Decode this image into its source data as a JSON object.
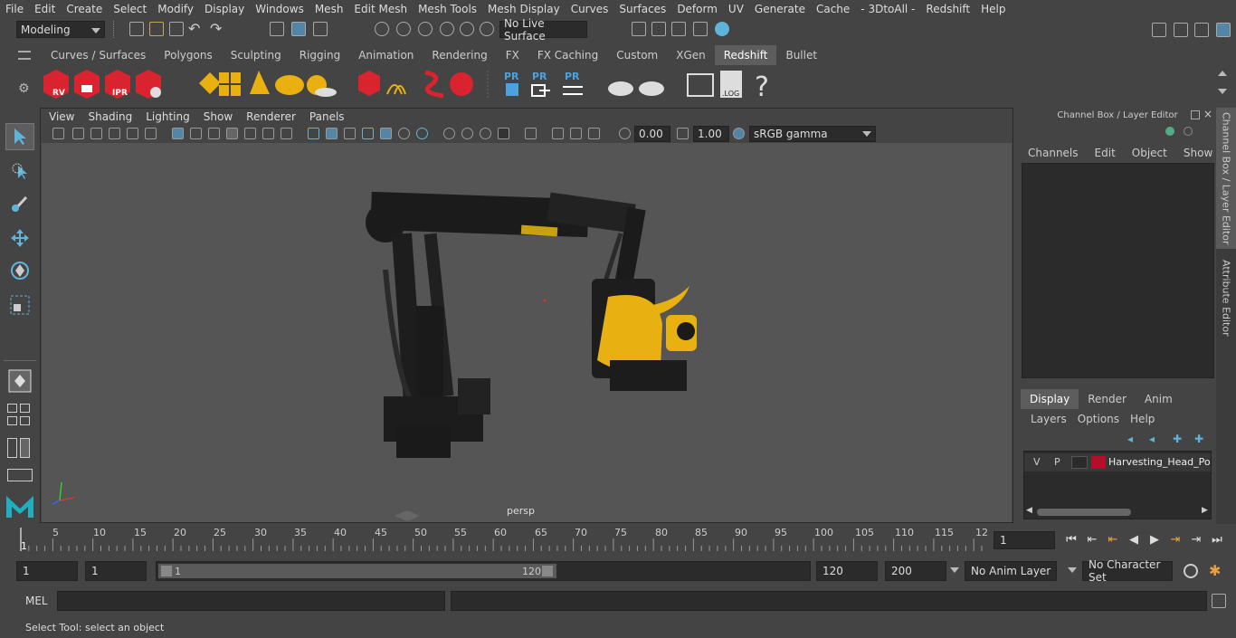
{
  "menubar": {
    "items": [
      "File",
      "Edit",
      "Create",
      "Select",
      "Modify",
      "Display",
      "Windows",
      "Mesh",
      "Edit Mesh",
      "Mesh Tools",
      "Mesh Display",
      "Curves",
      "Surfaces",
      "Deform",
      "UV",
      "Generate",
      "Cache",
      "- 3DtoAll -",
      "Redshift",
      "Help"
    ]
  },
  "status": {
    "workspace": "Modeling",
    "live_surface": "No Live Surface"
  },
  "shelf": {
    "tabs": [
      "Curves / Surfaces",
      "Polygons",
      "Sculpting",
      "Rigging",
      "Animation",
      "Rendering",
      "FX",
      "FX Caching",
      "Custom",
      "XGen",
      "Redshift",
      "Bullet"
    ],
    "active_tab": "Redshift",
    "icon_labels": {
      "rv": "RV",
      "ipr": "IPR",
      "pr": "PR",
      "log": ".LOG",
      "help": "?"
    }
  },
  "panel": {
    "menu": [
      "View",
      "Shading",
      "Lighting",
      "Show",
      "Renderer",
      "Panels"
    ],
    "exposure": "0.00",
    "gamma": "1.00",
    "colorspace": "sRGB gamma",
    "camera_label": "persp"
  },
  "channelbox": {
    "title": "Channel Box / Layer Editor",
    "menu": [
      "Channels",
      "Edit",
      "Object",
      "Show"
    ],
    "layer_tabs": [
      "Display",
      "Render",
      "Anim"
    ],
    "active_layer_tab": "Display",
    "layer_menu": [
      "Layers",
      "Options",
      "Help"
    ],
    "layer": {
      "v": "V",
      "p": "P",
      "name": "Harvesting_Head_Pons",
      "color": "#b0102a"
    }
  },
  "sidetabs": [
    "Channel Box / Layer Editor",
    "Attribute Editor"
  ],
  "timeline": {
    "ticks": [
      "5",
      "10",
      "15",
      "20",
      "25",
      "30",
      "35",
      "40",
      "45",
      "50",
      "55",
      "60",
      "65",
      "70",
      "75",
      "80",
      "85",
      "90",
      "95",
      "100",
      "105",
      "110",
      "115",
      "12"
    ],
    "start_marker": "1",
    "current_frame": "1"
  },
  "range": {
    "start": "1",
    "playback_start": "1",
    "slider_start": "1",
    "slider_end": "120",
    "playback_end": "120",
    "end": "200",
    "anim_layer": "No Anim Layer",
    "character_set": "No Character Set"
  },
  "cmdline": {
    "label": "MEL"
  },
  "helpline": {
    "text": "Select Tool: select an object"
  },
  "colors": {
    "accent": "#5285a6",
    "robot_yellow": "#e8b010",
    "redshift_red": "#d9232e"
  }
}
